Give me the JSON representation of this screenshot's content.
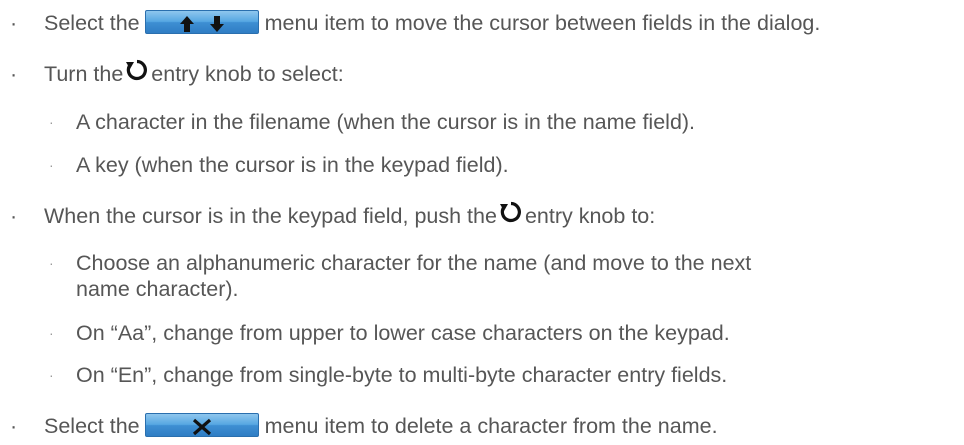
{
  "items": {
    "a_pre": "Select the",
    "a_post": "menu item to move the cursor between fields in the dialog.",
    "b_pre": "Turn the",
    "b_post": "entry knob to select:",
    "b_sub1": "A character in the filename (when the cursor is in the name field).",
    "b_sub2": "A key (when the cursor is in the keypad field).",
    "c_pre": "When the cursor is in the keypad field, push the",
    "c_post": "entry knob to:",
    "c_sub1_l1": "Choose an alphanumeric character for the name (and move to the next",
    "c_sub1_l2": "name character).",
    "c_sub2": "On “Aa”, change from upper to lower case characters on the keypad.",
    "c_sub3": "On “En”, change from single-byte to multi-byte character entry fields.",
    "d_pre": "Select the",
    "d_post": "menu item to delete a character from the name."
  },
  "bullet": "·",
  "icons": {
    "arrows_button": "up-down-arrows-menu-button",
    "knob": "entry-knob-icon",
    "delete_button": "delete-x-menu-button"
  },
  "colors": {
    "text": "#565656",
    "button": "#4a9ddc"
  }
}
